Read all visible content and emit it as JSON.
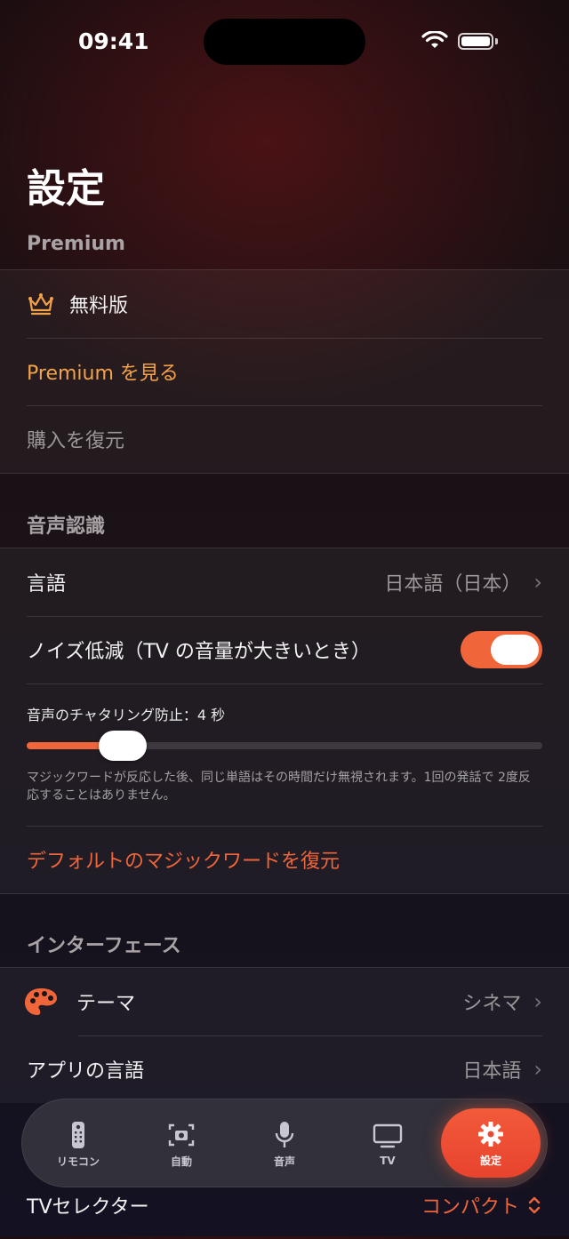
{
  "status": {
    "time": "09:41"
  },
  "page": {
    "title": "設定"
  },
  "premium": {
    "header": "Premium",
    "plan_label": "無料版",
    "see_premium": "Premium を見る",
    "restore": "購入を復元"
  },
  "voice": {
    "header": "音声認識",
    "language_label": "言語",
    "language_value": "日本語（日本）",
    "noise_label": "ノイズ低減（TV の音量が大きいとき）",
    "noise_enabled": true,
    "debounce_label": "音声のチャタリング防止：4 秒",
    "debounce_fraction": 0.14,
    "debounce_help": "マジックワードが反応した後、同じ単語はその時間だけ無視されます。1回の発話で 2度反応することはありません。",
    "restore_magic_words": "デフォルトのマジックワードを復元"
  },
  "interface": {
    "header": "インターフェース",
    "theme_label": "テーマ",
    "theme_value": "シネマ",
    "app_language_label": "アプリの言語",
    "app_language_value": "日本語",
    "tv_selector_label": "TVセレクター",
    "tv_selector_value": "コンパクト"
  },
  "tabs": [
    {
      "label": "リモコン",
      "icon": "remote-icon"
    },
    {
      "label": "自動",
      "icon": "camera-scan-icon"
    },
    {
      "label": "音声",
      "icon": "microphone-icon"
    },
    {
      "label": "TV",
      "icon": "tv-icon"
    },
    {
      "label": "設定",
      "icon": "gear-icon",
      "active": true
    }
  ],
  "colors": {
    "accent": "#f0663a",
    "premium": "#f2a24b"
  }
}
